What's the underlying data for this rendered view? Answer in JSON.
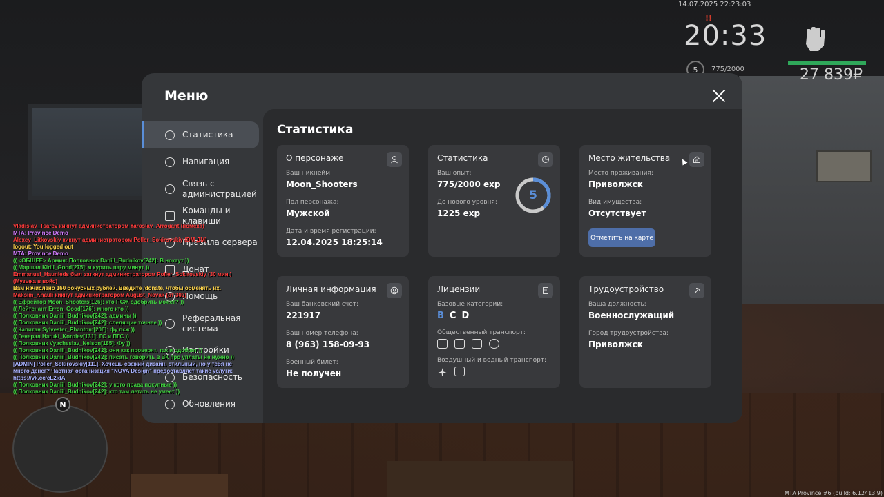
{
  "hud": {
    "datetime": "14.07.2025 22:23:03",
    "flag": "!!",
    "time": "20:33",
    "level": "5",
    "exp": "775/2000",
    "money": "27 839₽"
  },
  "menu": {
    "title": "Меню",
    "sidebar": [
      {
        "label": "Статистика",
        "icon": "pie-chart-icon",
        "active": true
      },
      {
        "label": "Навигация",
        "icon": "compass-icon",
        "active": false
      },
      {
        "label": "Связь с администрацией",
        "icon": "headset-icon",
        "active": false
      },
      {
        "label": "Команды и клавиши",
        "icon": "keyboard-icon",
        "active": false
      },
      {
        "label": "Правила сервера",
        "icon": "scales-icon",
        "active": false
      },
      {
        "label": "Донат",
        "icon": "gift-icon",
        "active": false
      },
      {
        "label": "Помощь",
        "icon": "help-icon",
        "active": false
      },
      {
        "label": "Реферальная система",
        "icon": "share-icon",
        "active": false
      },
      {
        "label": "Настройки",
        "icon": "gear-icon",
        "active": false
      },
      {
        "label": "Безопасность",
        "icon": "shield-icon",
        "active": false
      },
      {
        "label": "Обновления",
        "icon": "refresh-icon",
        "active": false
      }
    ],
    "content_title": "Статистика",
    "cards": {
      "character": {
        "title": "О персонаже",
        "nick_label": "Ваш никнейм:",
        "nick": "Moon_Shooters",
        "gender_label": "Пол персонажа:",
        "gender": "Мужской",
        "reg_label": "Дата и время регистрации:",
        "reg": "12.04.2025 18:25:14"
      },
      "stats": {
        "title": "Статистика",
        "exp_label": "Ваш опыт:",
        "exp": "775/2000 exp",
        "next_label": "До нового уровня:",
        "next": "1225 exp",
        "level": "5",
        "progress": 0.3875
      },
      "residence": {
        "title": "Место жительства",
        "place_label": "Место проживания:",
        "place": "Приволжск",
        "property_label": "Вид имущества:",
        "property": "Отсутствует",
        "map_button": "Отметить на карте"
      },
      "personal": {
        "title": "Личная информация",
        "bank_label": "Ваш банковский счет:",
        "bank": "221917",
        "phone_label": "Ваш номер телефона:",
        "phone": "8 (963) 158-09-93",
        "military_label": "Военный билет:",
        "military": "Не получен"
      },
      "licenses": {
        "title": "Лицензии",
        "base_label": "Базовые категории:",
        "cat_b": "B",
        "cat_c": "C",
        "cat_d": "D",
        "public_label": "Общественный транспорт:",
        "air_label": "Воздушный и водный транспорт:"
      },
      "employment": {
        "title": "Трудоустройство",
        "position_label": "Ваша должность:",
        "position": "Военнослужащий",
        "city_label": "Город трудоустройства:",
        "city": "Приволжск"
      }
    }
  },
  "chat": [
    {
      "text": "Vladislav_Tsarev кикнут администратором Yaroslav_Arrogant (помеха)",
      "color": "#ff3b3b"
    },
    {
      "text": "MTA: Province Demo",
      "color": "#d27bff"
    },
    {
      "text": "Alexey_Litkovskiy кикнут администратором Poller_Sokirovskiy (DM ДМ)",
      "color": "#ff3b3b"
    },
    {
      "text": "logout: You logged out",
      "color": "#ffd54a"
    },
    {
      "text": "MTA: Province Demo",
      "color": "#d27bff"
    },
    {
      "text": "(( <ОБЩЕЕ> Армия: Полковник Daniil_Budnikov[242]: В нокаут ))",
      "color": "#3fd03f"
    },
    {
      "text": "(( Маршал Kirill_Good[275]: я курить пару минут ))",
      "color": "#3fd03f"
    },
    {
      "text": "Emmanuel_Haunleds был заткнут администратором Poller_Sokirovskiy (30 мин.)",
      "color": "#ff3b3b"
    },
    {
      "text": "(Музыка в войс)",
      "color": "#ff3b3b"
    },
    {
      "text": "Вам начислено 160 бонусных рублей. Введите /donate, чтобы обменять их.",
      "color": "#ffd54a"
    },
    {
      "text": "Maksim_Knauli кикнут администратором August_Novak (от 300)",
      "color": "#ff3b3b"
    },
    {
      "text": "(( Ефрейтор Moon_Shooters[126]: кто ПСЖ одобрить может? ))",
      "color": "#3fd03f"
    },
    {
      "text": "(( Лейтенант Erron_Good[176]: много кто ))",
      "color": "#3fd03f"
    },
    {
      "text": "(( Полковник Daniil_Budnikov[242]: админы ))",
      "color": "#3fd03f"
    },
    {
      "text": "(( Полковник Daniil_Budnikov[242]: следящие точнее ))",
      "color": "#3fd03f"
    },
    {
      "text": "(( Капитан Sylvester_Phantom[206]: фу псж ))",
      "color": "#3fd03f"
    },
    {
      "text": "(( Генерал Haruki_Korolev[131]: ГС и ПГС ))",
      "color": "#3fd03f"
    },
    {
      "text": "(( Полковник Vyacheslav_Nelson[185]: Фу ))",
      "color": "#3fd03f"
    },
    {
      "text": "(( Полковник Daniil_Budnikov[242]: они как проверят, так и одобрят ))",
      "color": "#3fd03f"
    },
    {
      "text": "(( Полковник Daniil_Budnikov[242]: писать говорить в ВК про уплаты не нужно ))",
      "color": "#3fd03f"
    },
    {
      "text": "[ADMIN] Poller_Sokirovskiy[111]: Хочешь свежий дизайн, стильный, но у тебя не",
      "color": "#a9b2ff"
    },
    {
      "text": "много денег? Частная организация \"NOVA Design\" предоставляет такие услуги:",
      "color": "#a9b2ff"
    },
    {
      "text": " https://vk.cc/cL2idA",
      "color": "#a9b2ff"
    },
    {
      "text": "(( Полковник Daniil_Budnikov[242]: у кого права покупные ))",
      "color": "#3fd03f"
    },
    {
      "text": "(( Полковник Daniil_Budnikov[242]: кто там летать не умеет ))",
      "color": "#3fd03f"
    }
  ],
  "minimap": {
    "compass": "N"
  },
  "build": "MTA Province #6 (build: 6.12413.9)"
}
